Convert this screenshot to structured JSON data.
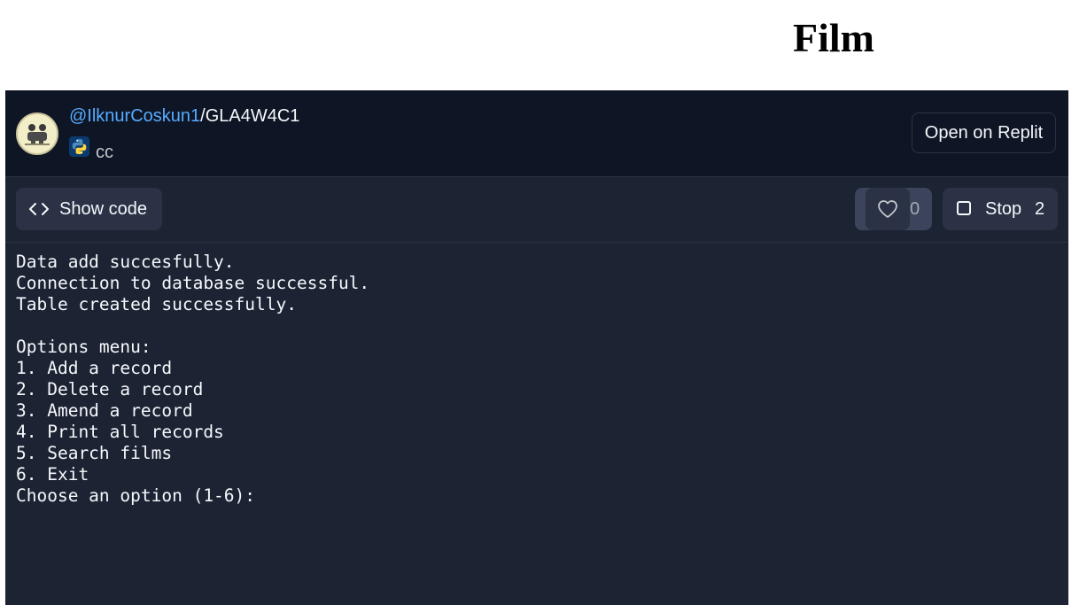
{
  "page": {
    "title": "Film"
  },
  "header": {
    "user": "@IlknurCoskun1",
    "separator": "/",
    "repl_name": "GLA4W4C1",
    "language_icon": "python-icon",
    "subtitle": "cc",
    "open_button": "Open on Replit"
  },
  "toolbar": {
    "show_code_label": "Show code",
    "like_count": "0",
    "stop_label": "Stop",
    "run_count": "2"
  },
  "console": {
    "lines": [
      "Data add succesfully.",
      "Connection to database successful.",
      "Table created successfully.",
      "",
      "Options menu:",
      "1. Add a record",
      "2. Delete a record",
      "3. Amend a record",
      "4. Print all records",
      "5. Search films",
      "6. Exit",
      "Choose an option (1-6):"
    ]
  },
  "colors": {
    "page_bg": "#ffffff",
    "header_bg": "#0e1525",
    "body_bg": "#1c2333",
    "button_bg": "#2b3245",
    "link_blue": "#57abff",
    "text": "#f5f9fc"
  }
}
